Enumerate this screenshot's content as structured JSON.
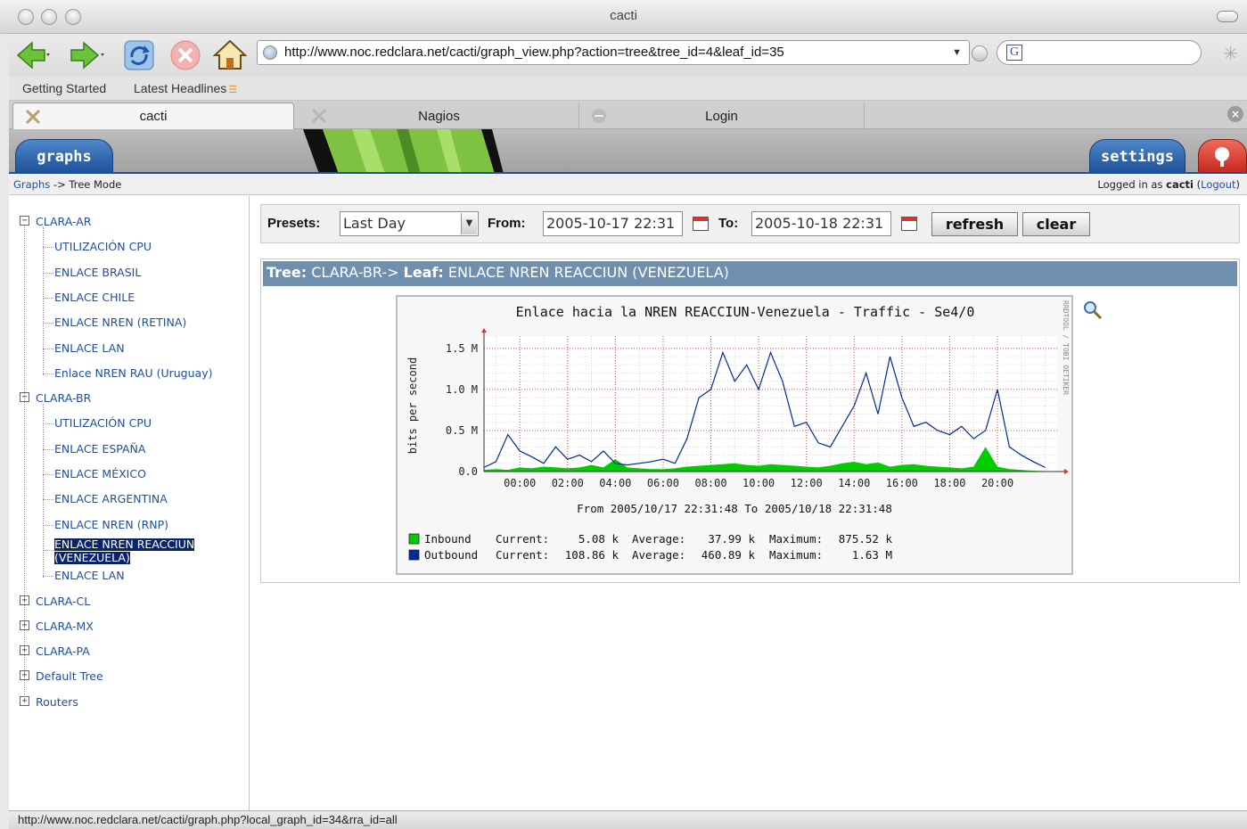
{
  "window": {
    "title": "cacti"
  },
  "toolbar": {
    "url": "http://www.noc.redclara.net/cacti/graph_view.php?action=tree&tree_id=4&leaf_id=35",
    "search_icon_letter": "G"
  },
  "bookmarks": {
    "items": [
      "Getting Started",
      "Latest Headlines"
    ]
  },
  "tabs": [
    "cacti",
    "Nagios",
    "Login"
  ],
  "nav": {
    "graphs": "graphs",
    "settings": "settings"
  },
  "breadcrumb": {
    "graphs": "Graphs",
    "sep": " -> ",
    "current": "Tree Mode"
  },
  "login": {
    "prefix": "Logged in as ",
    "user": "cacti",
    "open": " (",
    "logout": "Logout",
    "close": ")"
  },
  "tree": {
    "groups": [
      {
        "label": "CLARA-AR",
        "expanded": true,
        "children": [
          "UTILIZACIÓN CPU",
          "ENLACE BRASIL",
          "ENLACE CHILE",
          "ENLACE NREN (RETINA)",
          "ENLACE LAN",
          "Enlace NREN RAU (Uruguay)"
        ]
      },
      {
        "label": "CLARA-BR",
        "expanded": true,
        "children": [
          "UTILIZACIÓN CPU",
          "ENLACE ESPAÑA",
          "ENLACE MÉXICO",
          "ENLACE ARGENTINA",
          "ENLACE NREN (RNP)",
          "ENLACE NREN REACCIUN (VENEZUELA)",
          "ENLACE LAN"
        ]
      },
      {
        "label": "CLARA-CL",
        "expanded": false,
        "children": []
      },
      {
        "label": "CLARA-MX",
        "expanded": false,
        "children": []
      },
      {
        "label": "CLARA-PA",
        "expanded": false,
        "children": []
      },
      {
        "label": "Default Tree",
        "expanded": false,
        "children": []
      },
      {
        "label": "Routers",
        "expanded": false,
        "children": []
      }
    ],
    "selected_line1": "ENLACE NREN REACCIUN",
    "selected_line2": "(VENEZUELA)"
  },
  "presets": {
    "presets_label": "Presets:",
    "preset_value": "Last Day",
    "from_label": "From:",
    "from_value": "2005-10-17 22:31",
    "to_label": "To:",
    "to_value": "2005-10-18 22:31",
    "refresh": "refresh",
    "clear": "clear"
  },
  "panel": {
    "tree_label": "Tree:",
    "tree_value": " CLARA-BR-> ",
    "leaf_label": "Leaf:",
    "leaf_value": " ENLACE NREN REACCIUN (VENEZUELA)"
  },
  "chart_data": {
    "type": "area",
    "title": "Enlace hacia la NREN REACCIUN-Venezuela - Traffic - Se4/0",
    "ylabel": "bits per second",
    "xlabel": "From 2005/10/17 22:31:48 To 2005/10/18 22:31:48",
    "watermark": "RRDTOOL / TOBI OETIKER",
    "xlim": [
      -1.5,
      22.5
    ],
    "ylim": [
      0,
      1.65
    ],
    "y_ticks": [
      {
        "v": 0,
        "label": "0.0"
      },
      {
        "v": 0.5,
        "label": "0.5 M"
      },
      {
        "v": 1.0,
        "label": "1.0 M"
      },
      {
        "v": 1.5,
        "label": "1.5 M"
      }
    ],
    "x_ticks": [
      {
        "v": 0,
        "label": "00:00"
      },
      {
        "v": 2,
        "label": "02:00"
      },
      {
        "v": 4,
        "label": "04:00"
      },
      {
        "v": 6,
        "label": "06:00"
      },
      {
        "v": 8,
        "label": "08:00"
      },
      {
        "v": 10,
        "label": "10:00"
      },
      {
        "v": 12,
        "label": "12:00"
      },
      {
        "v": 14,
        "label": "14:00"
      },
      {
        "v": 16,
        "label": "16:00"
      },
      {
        "v": 18,
        "label": "18:00"
      },
      {
        "v": 20,
        "label": "20:00"
      }
    ],
    "series": [
      {
        "name": "Inbound",
        "color": "#00cc00",
        "x": [
          -1.5,
          -1.0,
          -0.5,
          0.0,
          0.5,
          1.0,
          1.5,
          2.0,
          2.5,
          3.0,
          3.5,
          4.0,
          4.5,
          5.0,
          5.5,
          6.0,
          6.5,
          7.0,
          7.5,
          8.0,
          8.5,
          9.0,
          9.5,
          10.0,
          10.5,
          11.0,
          11.5,
          12.0,
          12.5,
          13.0,
          13.5,
          14.0,
          14.5,
          15.0,
          15.5,
          16.0,
          16.5,
          17.0,
          17.5,
          18.0,
          18.5,
          19.0,
          19.5,
          20.0,
          20.5,
          21.0,
          21.5,
          22.0
        ],
        "y": [
          0.02,
          0.03,
          0.02,
          0.05,
          0.04,
          0.06,
          0.05,
          0.04,
          0.05,
          0.08,
          0.05,
          0.15,
          0.05,
          0.04,
          0.03,
          0.03,
          0.04,
          0.06,
          0.07,
          0.08,
          0.09,
          0.1,
          0.08,
          0.07,
          0.09,
          0.08,
          0.07,
          0.06,
          0.05,
          0.07,
          0.1,
          0.12,
          0.09,
          0.11,
          0.06,
          0.08,
          0.09,
          0.07,
          0.06,
          0.05,
          0.04,
          0.06,
          0.3,
          0.06,
          0.03,
          0.02,
          0.01,
          0.005
        ]
      },
      {
        "name": "Outbound",
        "color": "#002a97",
        "x": [
          -1.5,
          -1.0,
          -0.5,
          0.0,
          0.5,
          1.0,
          1.5,
          2.0,
          2.5,
          3.0,
          3.5,
          4.0,
          4.5,
          5.0,
          5.5,
          6.0,
          6.5,
          7.0,
          7.5,
          8.0,
          8.5,
          9.0,
          9.5,
          10.0,
          10.5,
          11.0,
          11.5,
          12.0,
          12.5,
          13.0,
          13.5,
          14.0,
          14.5,
          15.0,
          15.5,
          16.0,
          16.5,
          17.0,
          17.5,
          18.0,
          18.5,
          19.0,
          19.5,
          20.0,
          20.5,
          21.0,
          21.5,
          22.0
        ],
        "y": [
          0.05,
          0.12,
          0.45,
          0.25,
          0.18,
          0.1,
          0.3,
          0.15,
          0.2,
          0.12,
          0.25,
          0.1,
          0.08,
          0.1,
          0.12,
          0.15,
          0.1,
          0.4,
          0.9,
          1.0,
          1.45,
          1.1,
          1.3,
          1.0,
          1.45,
          1.1,
          0.55,
          0.6,
          0.35,
          0.3,
          0.55,
          0.8,
          1.2,
          0.7,
          1.4,
          0.9,
          0.55,
          0.6,
          0.5,
          0.45,
          0.55,
          0.4,
          0.5,
          1.0,
          0.3,
          0.2,
          0.12,
          0.05
        ]
      }
    ],
    "legend": [
      {
        "name": "Inbound",
        "current_label": "Current:",
        "current": "5.08 k",
        "average_label": "Average:",
        "average": "37.99 k",
        "maximum_label": "Maximum:",
        "maximum": "875.52 k"
      },
      {
        "name": "Outbound",
        "current_label": "Current:",
        "current": "108.86 k",
        "average_label": "Average:",
        "average": "460.89 k",
        "maximum_label": "Maximum:",
        "maximum": "1.63 M"
      }
    ]
  },
  "statusbar": {
    "text": "http://www.noc.redclara.net/cacti/graph.php?local_graph_id=34&rra_id=all"
  },
  "colors": {
    "accent": "#1f4f9c",
    "header": "#6f8faf",
    "selection": "#0a246a"
  }
}
